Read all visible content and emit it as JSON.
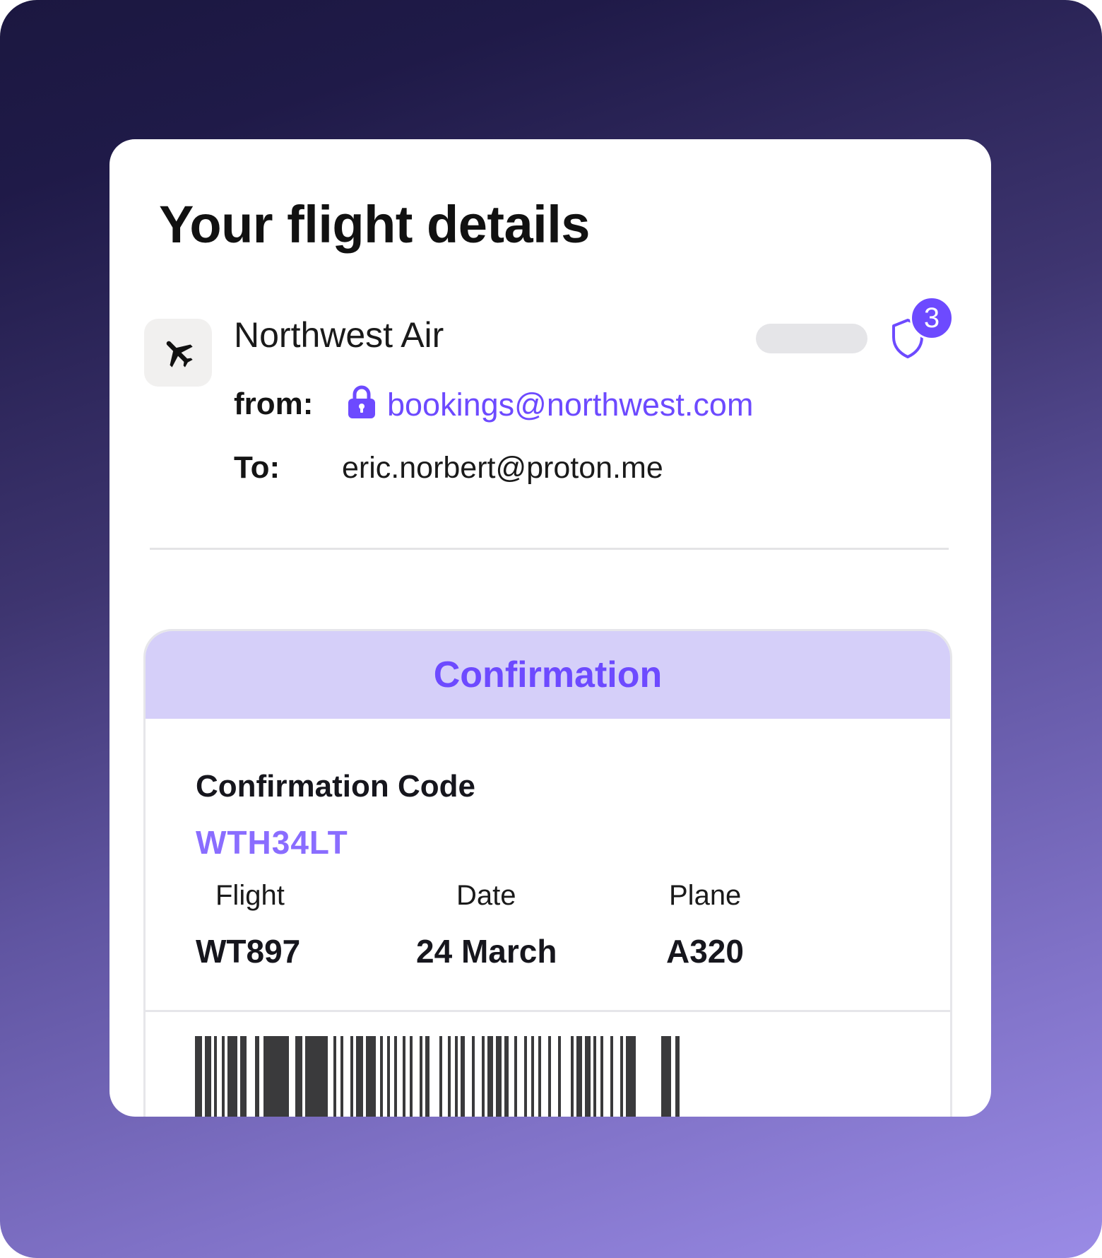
{
  "email": {
    "title": "Your flight details",
    "sender": {
      "name": "Northwest Air",
      "avatar_icon": "airplane-icon",
      "security_icon": "shield-icon",
      "security_badge_count": "3"
    },
    "from_label": "from:",
    "from_address": "bookings@northwest.com",
    "from_icon": "lock-icon",
    "to_label": "To:",
    "to_address": "eric.norbert@proton.me"
  },
  "confirmation": {
    "header": "Confirmation",
    "code_label": "Confirmation Code",
    "code_value": "WTH34LT",
    "details": {
      "flight_label": "Flight",
      "flight_value": "WT897",
      "date_label": "Date",
      "date_value": "24 March",
      "plane_label": "Plane",
      "plane_value": "A320"
    },
    "barcode_icon": "barcode"
  },
  "colors": {
    "accent": "#6d4aff",
    "code_accent": "#8a6dff",
    "confirmation_header_bg": "#d5cff9",
    "barcode": "#3a3a3c",
    "background_top": "#1b1740",
    "background_bottom": "#9a8be6"
  }
}
